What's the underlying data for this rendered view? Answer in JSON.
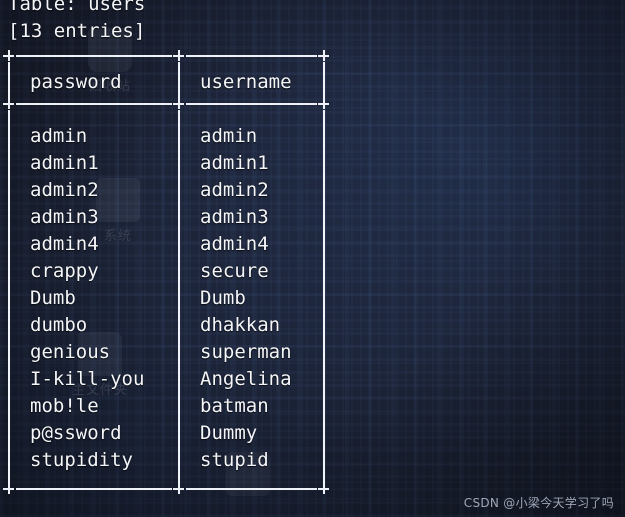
{
  "terminal": {
    "table_line": "Table: users",
    "entries_line": "[13 entries]",
    "columns": [
      "password",
      "username"
    ],
    "rows": [
      {
        "password": "admin",
        "username": "admin"
      },
      {
        "password": "admin1",
        "username": "admin1"
      },
      {
        "password": "admin2",
        "username": "admin2"
      },
      {
        "password": "admin3",
        "username": "admin3"
      },
      {
        "password": "admin4",
        "username": "admin4"
      },
      {
        "password": "crappy",
        "username": "secure"
      },
      {
        "password": "Dumb",
        "username": "Dumb"
      },
      {
        "password": "dumbo",
        "username": "dhakkan"
      },
      {
        "password": "genious",
        "username": "superman"
      },
      {
        "password": "I-kill-you",
        "username": "Angelina"
      },
      {
        "password": "mob!le",
        "username": "batman"
      },
      {
        "password": "p@ssword",
        "username": "Dummy"
      },
      {
        "password": "stupidity",
        "username": "stupid"
      }
    ]
  },
  "desktop": {
    "icons": [
      {
        "label": "回收站",
        "icon": "recycle-bin-icon"
      },
      {
        "label": "系统",
        "icon": "system-icon"
      },
      {
        "label": "主文件夹",
        "icon": "home-folder-icon"
      },
      {
        "label": "",
        "icon": "document-icon"
      }
    ]
  },
  "watermark": {
    "text": "CSDN @小梁今天学习了吗"
  },
  "colors": {
    "background": "#1b2030",
    "text": "#f4f6fa",
    "rule": "#eef1f7",
    "watermark": "#aab3c4"
  }
}
